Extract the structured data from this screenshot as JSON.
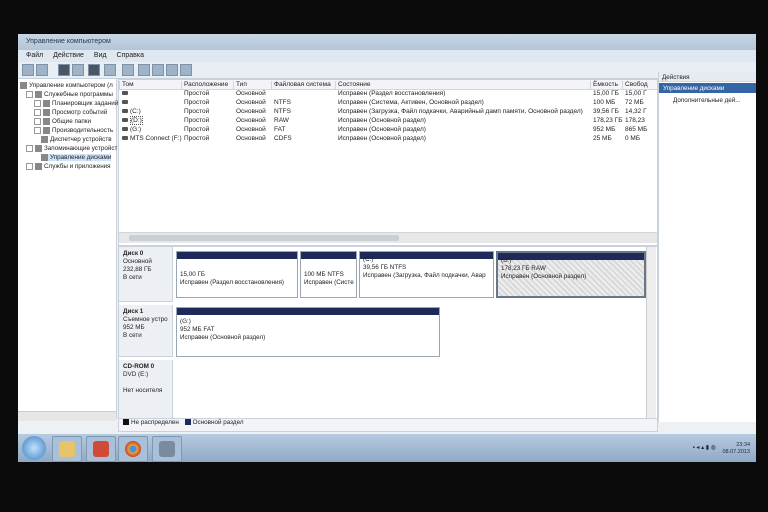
{
  "window": {
    "title": "Управление компьютером"
  },
  "menu": [
    "Файл",
    "Действие",
    "Вид",
    "Справка"
  ],
  "tree": {
    "items": [
      {
        "label": "Управление компьютером (л",
        "level": 0,
        "expanded": true
      },
      {
        "label": "Служебные программы",
        "level": 1,
        "expanded": true
      },
      {
        "label": "Планировщик заданий",
        "level": 2
      },
      {
        "label": "Просмотр событий",
        "level": 2
      },
      {
        "label": "Общие папки",
        "level": 2
      },
      {
        "label": "Производительность",
        "level": 2
      },
      {
        "label": "Диспетчер устройств",
        "level": 2
      },
      {
        "label": "Запоминающие устройст",
        "level": 1,
        "expanded": true
      },
      {
        "label": "Управление дисками",
        "level": 2,
        "selected": true
      },
      {
        "label": "Службы и приложения",
        "level": 1
      }
    ]
  },
  "volumes": {
    "columns": [
      "Том",
      "Расположение",
      "Тип",
      "Файловая система",
      "Состояние",
      "Ёмкость",
      "Свобод"
    ],
    "rows": [
      [
        "",
        "Простой",
        "Основной",
        "",
        "Исправен (Раздел восстановления)",
        "15,00 ГБ",
        "15,00 Г"
      ],
      [
        "",
        "Простой",
        "Основной",
        "NTFS",
        "Исправен (Система, Активен, Основной раздел)",
        "100 МБ",
        "72 МБ"
      ],
      [
        "(C:)",
        "Простой",
        "Основной",
        "NTFS",
        "Исправен (Загрузка, Файл подкачки, Аварийный дамп памяти, Основной раздел)",
        "39,56 ГБ",
        "14,32 Г"
      ],
      [
        "(D:)",
        "Простой",
        "Основной",
        "RAW",
        "Исправен (Основной раздел)",
        "178,23 ГБ",
        "178,23"
      ],
      [
        "(G:)",
        "Простой",
        "Основной",
        "FAT",
        "Исправен (Основной раздел)",
        "952 МБ",
        "865 МБ"
      ],
      [
        "MTS Connect (F:)",
        "Простой",
        "Основной",
        "CDFS",
        "Исправен (Основной раздел)",
        "25 МБ",
        "0 МБ"
      ]
    ]
  },
  "disks": [
    {
      "name": "Диск 0",
      "type": "Основной",
      "size": "232,88 ГБ",
      "status": "В сети",
      "partitions": [
        {
          "title": "",
          "size": "15,00 ГБ",
          "status": "Исправен (Раздел восстановления)"
        },
        {
          "title": "",
          "size": "100 МБ NTFS",
          "status": "Исправен (Систе"
        },
        {
          "title": "(C:)",
          "size": "39,56 ГБ NTFS",
          "status": "Исправен (Загрузка, Файл подкачки, Авар"
        },
        {
          "title": "(D:)",
          "size": "178,23 ГБ RAW",
          "status": "Исправен (Основной раздел)"
        }
      ]
    },
    {
      "name": "Диск 1",
      "type": "Съемное устро",
      "size": "952 МБ",
      "status": "В сети",
      "partitions": [
        {
          "title": "(G:)",
          "size": "952 МБ FAT",
          "status": "Исправен (Основной раздел)"
        }
      ]
    },
    {
      "name": "CD-ROM 0",
      "type": "DVD (E:)",
      "size": "",
      "status": "Нет носителя",
      "partitions": []
    }
  ],
  "legend": {
    "unallocated": "Не распределен",
    "primary": "Основной раздел"
  },
  "actions": {
    "header": "Действия",
    "selected": "Управление дисками",
    "more": "Дополнительные дей..."
  },
  "tray": {
    "time": "23:34",
    "date": "08.07.2013"
  },
  "colors": {
    "partition_bar": "#1d2a5a",
    "unallocated": "#111111",
    "primary": "#1d2a5a",
    "selection": "#3465a4"
  }
}
